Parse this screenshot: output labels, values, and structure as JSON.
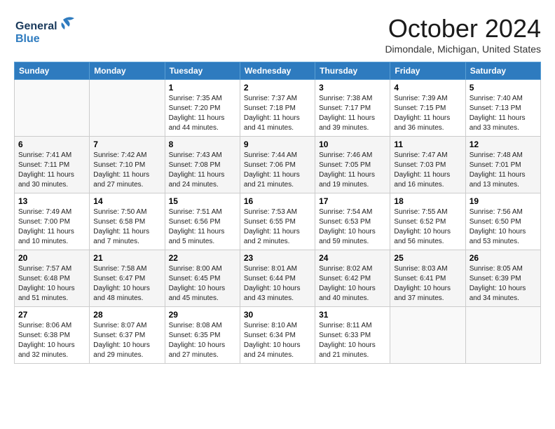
{
  "header": {
    "logo_line1": "General",
    "logo_line2": "Blue",
    "month_title": "October 2024",
    "location": "Dimondale, Michigan, United States"
  },
  "days_of_week": [
    "Sunday",
    "Monday",
    "Tuesday",
    "Wednesday",
    "Thursday",
    "Friday",
    "Saturday"
  ],
  "weeks": [
    [
      {
        "day": "",
        "sunrise": "",
        "sunset": "",
        "daylight": ""
      },
      {
        "day": "",
        "sunrise": "",
        "sunset": "",
        "daylight": ""
      },
      {
        "day": "1",
        "sunrise": "Sunrise: 7:35 AM",
        "sunset": "Sunset: 7:20 PM",
        "daylight": "Daylight: 11 hours and 44 minutes."
      },
      {
        "day": "2",
        "sunrise": "Sunrise: 7:37 AM",
        "sunset": "Sunset: 7:18 PM",
        "daylight": "Daylight: 11 hours and 41 minutes."
      },
      {
        "day": "3",
        "sunrise": "Sunrise: 7:38 AM",
        "sunset": "Sunset: 7:17 PM",
        "daylight": "Daylight: 11 hours and 39 minutes."
      },
      {
        "day": "4",
        "sunrise": "Sunrise: 7:39 AM",
        "sunset": "Sunset: 7:15 PM",
        "daylight": "Daylight: 11 hours and 36 minutes."
      },
      {
        "day": "5",
        "sunrise": "Sunrise: 7:40 AM",
        "sunset": "Sunset: 7:13 PM",
        "daylight": "Daylight: 11 hours and 33 minutes."
      }
    ],
    [
      {
        "day": "6",
        "sunrise": "Sunrise: 7:41 AM",
        "sunset": "Sunset: 7:11 PM",
        "daylight": "Daylight: 11 hours and 30 minutes."
      },
      {
        "day": "7",
        "sunrise": "Sunrise: 7:42 AM",
        "sunset": "Sunset: 7:10 PM",
        "daylight": "Daylight: 11 hours and 27 minutes."
      },
      {
        "day": "8",
        "sunrise": "Sunrise: 7:43 AM",
        "sunset": "Sunset: 7:08 PM",
        "daylight": "Daylight: 11 hours and 24 minutes."
      },
      {
        "day": "9",
        "sunrise": "Sunrise: 7:44 AM",
        "sunset": "Sunset: 7:06 PM",
        "daylight": "Daylight: 11 hours and 21 minutes."
      },
      {
        "day": "10",
        "sunrise": "Sunrise: 7:46 AM",
        "sunset": "Sunset: 7:05 PM",
        "daylight": "Daylight: 11 hours and 19 minutes."
      },
      {
        "day": "11",
        "sunrise": "Sunrise: 7:47 AM",
        "sunset": "Sunset: 7:03 PM",
        "daylight": "Daylight: 11 hours and 16 minutes."
      },
      {
        "day": "12",
        "sunrise": "Sunrise: 7:48 AM",
        "sunset": "Sunset: 7:01 PM",
        "daylight": "Daylight: 11 hours and 13 minutes."
      }
    ],
    [
      {
        "day": "13",
        "sunrise": "Sunrise: 7:49 AM",
        "sunset": "Sunset: 7:00 PM",
        "daylight": "Daylight: 11 hours and 10 minutes."
      },
      {
        "day": "14",
        "sunrise": "Sunrise: 7:50 AM",
        "sunset": "Sunset: 6:58 PM",
        "daylight": "Daylight: 11 hours and 7 minutes."
      },
      {
        "day": "15",
        "sunrise": "Sunrise: 7:51 AM",
        "sunset": "Sunset: 6:56 PM",
        "daylight": "Daylight: 11 hours and 5 minutes."
      },
      {
        "day": "16",
        "sunrise": "Sunrise: 7:53 AM",
        "sunset": "Sunset: 6:55 PM",
        "daylight": "Daylight: 11 hours and 2 minutes."
      },
      {
        "day": "17",
        "sunrise": "Sunrise: 7:54 AM",
        "sunset": "Sunset: 6:53 PM",
        "daylight": "Daylight: 10 hours and 59 minutes."
      },
      {
        "day": "18",
        "sunrise": "Sunrise: 7:55 AM",
        "sunset": "Sunset: 6:52 PM",
        "daylight": "Daylight: 10 hours and 56 minutes."
      },
      {
        "day": "19",
        "sunrise": "Sunrise: 7:56 AM",
        "sunset": "Sunset: 6:50 PM",
        "daylight": "Daylight: 10 hours and 53 minutes."
      }
    ],
    [
      {
        "day": "20",
        "sunrise": "Sunrise: 7:57 AM",
        "sunset": "Sunset: 6:48 PM",
        "daylight": "Daylight: 10 hours and 51 minutes."
      },
      {
        "day": "21",
        "sunrise": "Sunrise: 7:58 AM",
        "sunset": "Sunset: 6:47 PM",
        "daylight": "Daylight: 10 hours and 48 minutes."
      },
      {
        "day": "22",
        "sunrise": "Sunrise: 8:00 AM",
        "sunset": "Sunset: 6:45 PM",
        "daylight": "Daylight: 10 hours and 45 minutes."
      },
      {
        "day": "23",
        "sunrise": "Sunrise: 8:01 AM",
        "sunset": "Sunset: 6:44 PM",
        "daylight": "Daylight: 10 hours and 43 minutes."
      },
      {
        "day": "24",
        "sunrise": "Sunrise: 8:02 AM",
        "sunset": "Sunset: 6:42 PM",
        "daylight": "Daylight: 10 hours and 40 minutes."
      },
      {
        "day": "25",
        "sunrise": "Sunrise: 8:03 AM",
        "sunset": "Sunset: 6:41 PM",
        "daylight": "Daylight: 10 hours and 37 minutes."
      },
      {
        "day": "26",
        "sunrise": "Sunrise: 8:05 AM",
        "sunset": "Sunset: 6:39 PM",
        "daylight": "Daylight: 10 hours and 34 minutes."
      }
    ],
    [
      {
        "day": "27",
        "sunrise": "Sunrise: 8:06 AM",
        "sunset": "Sunset: 6:38 PM",
        "daylight": "Daylight: 10 hours and 32 minutes."
      },
      {
        "day": "28",
        "sunrise": "Sunrise: 8:07 AM",
        "sunset": "Sunset: 6:37 PM",
        "daylight": "Daylight: 10 hours and 29 minutes."
      },
      {
        "day": "29",
        "sunrise": "Sunrise: 8:08 AM",
        "sunset": "Sunset: 6:35 PM",
        "daylight": "Daylight: 10 hours and 27 minutes."
      },
      {
        "day": "30",
        "sunrise": "Sunrise: 8:10 AM",
        "sunset": "Sunset: 6:34 PM",
        "daylight": "Daylight: 10 hours and 24 minutes."
      },
      {
        "day": "31",
        "sunrise": "Sunrise: 8:11 AM",
        "sunset": "Sunset: 6:33 PM",
        "daylight": "Daylight: 10 hours and 21 minutes."
      },
      {
        "day": "",
        "sunrise": "",
        "sunset": "",
        "daylight": ""
      },
      {
        "day": "",
        "sunrise": "",
        "sunset": "",
        "daylight": ""
      }
    ]
  ]
}
